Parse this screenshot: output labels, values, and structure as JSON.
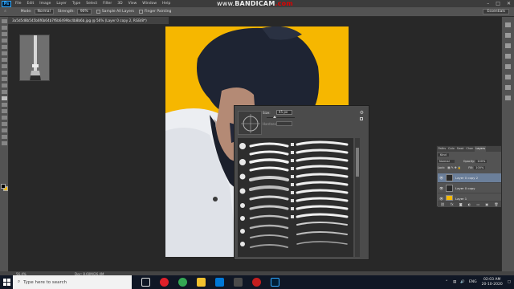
{
  "app": {
    "logo": "Ps",
    "watermark_prefix": "www.",
    "watermark_brand": "BANDICAM",
    "watermark_suffix": ".com"
  },
  "menu": [
    "File",
    "Edit",
    "Image",
    "Layer",
    "Type",
    "Select",
    "Filter",
    "3D",
    "View",
    "Window",
    "Help"
  ],
  "window_controls": [
    "–",
    "□",
    "✕"
  ],
  "options": {
    "mode_label": "Mode:",
    "mode_value": "Normal",
    "strength_label": "Strength:",
    "strength_value": "90%",
    "sample_all_layers": "Sample All Layers",
    "finger_painting": "Finger Painting",
    "workspace": "Essentials"
  },
  "document_tab": "3a5d5d8b545b6f6b64b7f6b6499bc4b8b6b.jpg @ 56% (Layer 0 copy 2, RGB/8*)",
  "brush_panel": {
    "size_label": "Size:",
    "size_value": "45 px",
    "hardness_label": "Hardness:"
  },
  "layers": {
    "tabs": [
      "Paths",
      "Colo",
      "Swat",
      "Chan",
      "Layers"
    ],
    "kind_label": "Kind",
    "blend": "Normal",
    "opacity_label": "Opacity:",
    "opacity_value": "100%",
    "lock_label": "Lock:",
    "fill_label": "Fill:",
    "fill_value": "100%",
    "items": [
      {
        "name": "Layer 0 copy 2",
        "selected": true
      },
      {
        "name": "Layer 0 copy",
        "selected": false
      },
      {
        "name": "Layer 1",
        "selected": false
      }
    ],
    "footer_icons": [
      "link-icon",
      "fx-icon",
      "mask-icon",
      "adjustment-icon",
      "folder-icon",
      "new-layer-icon",
      "trash-icon"
    ]
  },
  "status": {
    "zoom": "56.4%",
    "doc": "Doc: 8.60M/26.4M"
  },
  "taskbar": {
    "search_placeholder": "Type here to search",
    "language": "ENG",
    "time": "02:03 AM",
    "date": "20-10-2020"
  },
  "colors": {
    "foreground": "#000000",
    "background": "#f6b900",
    "photo_bg": "#f6b700"
  }
}
